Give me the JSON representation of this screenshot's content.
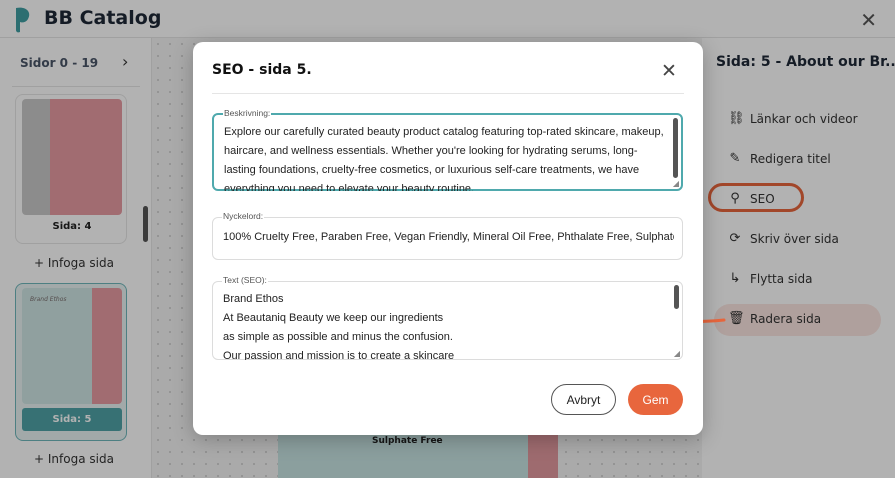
{
  "app": {
    "title": "BB Catalog"
  },
  "left_panel": {
    "header": "Sidor 0 - 19",
    "pages": [
      {
        "label": "Sida: 4"
      },
      {
        "label": "Sida: 5",
        "active": true,
        "thumb_title": "Brand Ethos"
      }
    ],
    "insert_label": "+ Infoga sida"
  },
  "canvas": {
    "visible_text": "Sulphate Free"
  },
  "right_panel": {
    "title": "Sida: 5 - About our Br...",
    "items": [
      {
        "label": "Länkar och videor",
        "icon": "link-icon"
      },
      {
        "label": "Redigera titel",
        "icon": "pencil-icon"
      },
      {
        "label": "SEO",
        "icon": "search-icon"
      },
      {
        "label": "Skriv över sida",
        "icon": "refresh-icon"
      },
      {
        "label": "Flytta sida",
        "icon": "move-icon"
      },
      {
        "label": "Radera sida",
        "icon": "trash-icon"
      }
    ]
  },
  "modal": {
    "title": "SEO - sida 5.",
    "description": {
      "label": "Beskrivning:",
      "value": "Explore our carefully curated beauty product catalog featuring top-rated skincare, makeup, haircare, and wellness essentials. Whether you're looking for hydrating serums, long-lasting foundations, cruelty-free cosmetics, or luxurious self-care treatments, we have everything you need to elevate your beauty routine."
    },
    "keywords": {
      "label": "Nyckelord:",
      "value": "100% Cruelty Free, Paraben Free, Vegan Friendly, Mineral Oil Free, Phthalate Free, Sulphate Free"
    },
    "seo_text": {
      "label": "Text (SEO):",
      "value": "Brand Ethos\nAt Beautaniq Beauty we keep our ingredients\nas simple as possible and minus the confusion.\nOur passion and mission is to create a skincare"
    },
    "cancel_label": "Avbryt",
    "save_label": "Gem"
  },
  "colors": {
    "accent": "#e8663d",
    "teal": "#4fa9ad"
  }
}
